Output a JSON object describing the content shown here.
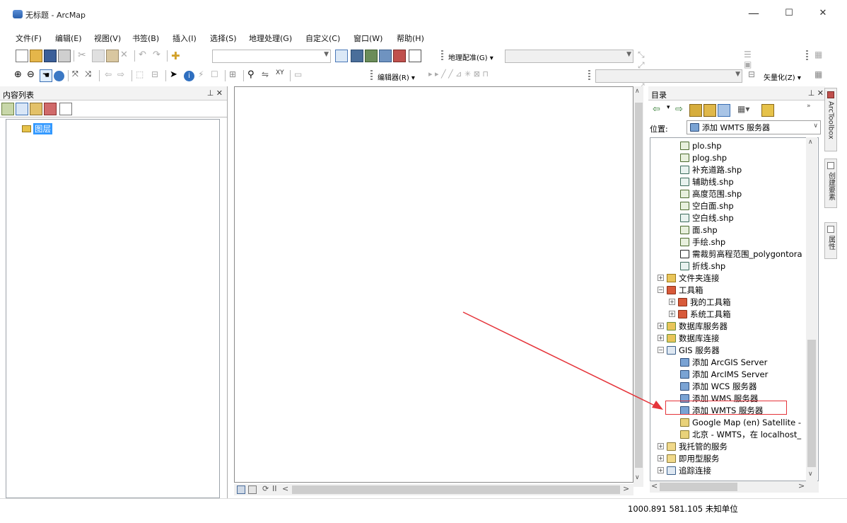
{
  "window": {
    "title": "无标题 - ArcMap",
    "minimize": "—",
    "maximize": "☐",
    "close": "✕"
  },
  "menu": [
    {
      "label": "文件(F)"
    },
    {
      "label": "编辑(E)"
    },
    {
      "label": "视图(V)"
    },
    {
      "label": "书签(B)"
    },
    {
      "label": "插入(I)"
    },
    {
      "label": "选择(S)"
    },
    {
      "label": "地理处理(G)"
    },
    {
      "label": "自定义(C)"
    },
    {
      "label": "窗口(W)"
    },
    {
      "label": "帮助(H)"
    }
  ],
  "toolbar": {
    "georef_label": "地理配准(G) ▾",
    "editor_label": "编辑器(R) ▾",
    "vectorize_label": "矢量化(Z) ▾"
  },
  "toc": {
    "title": "内容列表",
    "layers_label": "图层"
  },
  "catalog": {
    "title": "目录",
    "location_label": "位置:",
    "location_value": "添加 WMTS 服务器",
    "items": [
      {
        "label": "plo.shp",
        "icon": "polygon-shapefile-icon"
      },
      {
        "label": "plog.shp",
        "icon": "polygon-shapefile-icon"
      },
      {
        "label": "补充道路.shp",
        "icon": "line-shapefile-icon"
      },
      {
        "label": "辅助线.shp",
        "icon": "line-shapefile-icon"
      },
      {
        "label": "高度范围.shp",
        "icon": "polygon-shapefile-icon"
      },
      {
        "label": "空白面.shp",
        "icon": "polygon-shapefile-icon"
      },
      {
        "label": "空白线.shp",
        "icon": "line-shapefile-icon"
      },
      {
        "label": "面.shp",
        "icon": "polygon-shapefile-icon"
      },
      {
        "label": "手绘.shp",
        "icon": "polygon-shapefile-icon"
      },
      {
        "label": "需裁剪高程范围_polygontora",
        "icon": "checked-layer-icon"
      },
      {
        "label": "折线.shp",
        "icon": "line-shapefile-icon"
      },
      {
        "label": "文件夹连接",
        "icon": "folder-connection-icon",
        "expander": "+"
      },
      {
        "label": "工具箱",
        "icon": "toolbox-icon",
        "expander": "−"
      },
      {
        "label": "我的工具箱",
        "icon": "toolbox-icon",
        "expander": "+"
      },
      {
        "label": "系统工具箱",
        "icon": "toolbox-icon",
        "expander": "+"
      },
      {
        "label": "数据库服务器",
        "icon": "database-server-icon",
        "expander": "+"
      },
      {
        "label": "数据库连接",
        "icon": "database-connection-icon",
        "expander": "+"
      },
      {
        "label": "GIS 服务器",
        "icon": "gis-server-icon",
        "expander": "−"
      },
      {
        "label": "添加 ArcGIS Server",
        "icon": "add-server-icon"
      },
      {
        "label": "添加 ArcIMS Server",
        "icon": "add-server-icon"
      },
      {
        "label": "添加 WCS 服务器",
        "icon": "add-server-icon"
      },
      {
        "label": "添加 WMS 服务器",
        "icon": "add-server-icon"
      },
      {
        "label": "添加 WMTS 服务器",
        "icon": "add-server-icon"
      },
      {
        "label": "Google Map (en) Satellite -",
        "icon": "wmts-service-icon"
      },
      {
        "label": "北京 - WMTS，在 localhost_",
        "icon": "wmts-service-icon"
      },
      {
        "label": "我托管的服务",
        "icon": "hosted-services-icon",
        "expander": "+"
      },
      {
        "label": "即用型服务",
        "icon": "ready-services-icon",
        "expander": "+"
      },
      {
        "label": "追踪连接",
        "icon": "tracking-connection-icon",
        "expander": "+"
      }
    ]
  },
  "side_tabs": {
    "arctoolbox": "ArcToolbox",
    "create_features": "创建要素",
    "attributes": "属性"
  },
  "status": {
    "coords": "1000.891  581.105 未知单位"
  },
  "colors": {
    "annotation_red": "#e5343a",
    "selection_blue": "#3399ff"
  }
}
